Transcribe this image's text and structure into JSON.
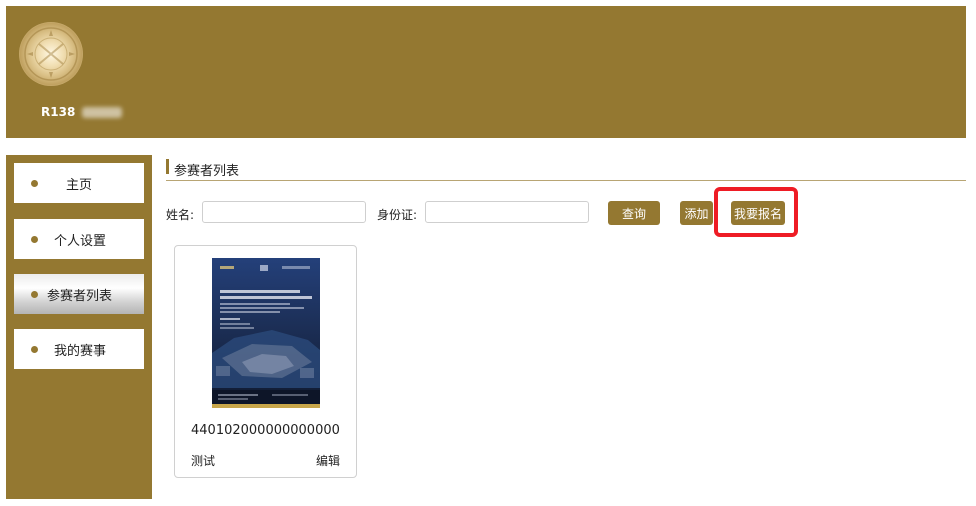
{
  "header": {
    "username": "R138"
  },
  "sidebar": {
    "items": [
      {
        "label": "主页"
      },
      {
        "label": "个人设置"
      },
      {
        "label": "参赛者列表"
      },
      {
        "label": "我的赛事"
      }
    ]
  },
  "section": {
    "title": "参赛者列表"
  },
  "search": {
    "name_label": "姓名:",
    "name_value": "",
    "id_label": "身份证:",
    "id_value": "",
    "query_button": "查询",
    "add_button": "添加",
    "register_button": "我要报名"
  },
  "card": {
    "id_number": "440102000000000000",
    "name": "测试",
    "edit_label": "编辑"
  },
  "colors": {
    "brand": "#947831",
    "highlight": "#ee1c25",
    "poster_bg": "#1c2f57"
  },
  "icons": {
    "avatar": "avatar-emblem",
    "nav_bullet": "bullet-dot-icon"
  }
}
